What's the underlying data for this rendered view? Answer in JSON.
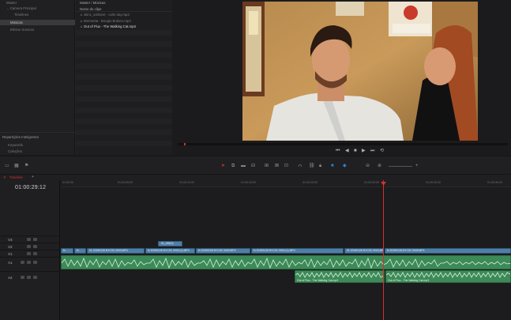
{
  "media_pool": {
    "bins": [
      {
        "label": "Master",
        "active": false
      },
      {
        "label": "Camera Principal",
        "active": false
      },
      {
        "label": "Timelines",
        "active": false
      },
      {
        "label": "Músicas",
        "active": true
      },
      {
        "label": "Efeitos Sonoros",
        "active": false
      }
    ],
    "smart_bins_title": "Repartições Inteligentes",
    "smart_bins": [
      "Keywords",
      "Coleções"
    ],
    "path": "Master / Músicas",
    "column_header": "Nome do clipe",
    "clips": [
      {
        "label": "skinz_ambient - calm day.mp3",
        "active": false
      },
      {
        "label": "Mermetta - Boogie Broken.mp3",
        "active": false
      },
      {
        "label": "Out of Flux - The Walking Cat.mp3",
        "active": true
      }
    ]
  },
  "viewer": {
    "transport": [
      "⏮",
      "◀",
      "■",
      "▶",
      "⏭",
      "⟲"
    ]
  },
  "timeline": {
    "name": "Timeline",
    "timecode": "01:00:29:12",
    "ruler_labels": [
      "01:00:00",
      "01:00:05:00",
      "01:00:10:00",
      "01:00:15:00",
      "01:00:20:00",
      "01:00:25:00",
      "01:00:30:00",
      "01:00:35:00"
    ],
    "tracks": [
      "V3",
      "V2",
      "V1",
      "A1",
      "A2"
    ],
    "marker_label": "01_000(0)",
    "video_clips": [
      {
        "label": "fx",
        "start": 0,
        "end": 16
      },
      {
        "label": "fx",
        "start": 17,
        "end": 32
      },
      {
        "label": "01 20190128 NYC3C 0003.MP4",
        "start": 33,
        "end": 106
      },
      {
        "label": "fx  20190128 NYC3C 0003 (1).MP4",
        "start": 107,
        "end": 170
      },
      {
        "label": "fx 20190128 NYC3C 0003.MP4",
        "start": 171,
        "end": 240
      },
      {
        "label": "fx  20190128 NYC3C 0004 (1).MP4",
        "start": 241,
        "end": 358
      },
      {
        "label": "01 20190128 NYC3C 0004.MP4",
        "start": 359,
        "end": 409
      },
      {
        "label": "fx  20190128 NYC3C 0005.MP4",
        "start": 410,
        "end": 570
      }
    ],
    "audio_a2": [
      {
        "label": "Out of Flux - The Walking Cat.mp3",
        "start": 296,
        "end": 410
      },
      {
        "label": "Out of Flux - The Walking Cat.mp3",
        "start": 411,
        "end": 570
      }
    ]
  },
  "colors": {
    "video_clip": "#4f7ea6",
    "audio_clip": "#3c8a57",
    "playhead": "#d33030",
    "accent": "#2e7fd6"
  }
}
